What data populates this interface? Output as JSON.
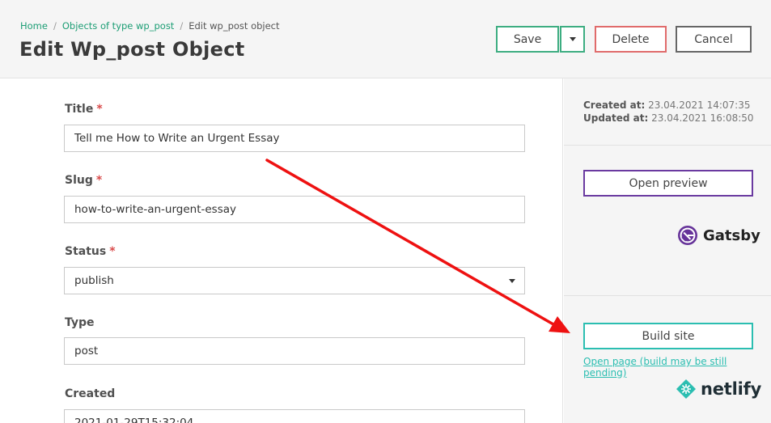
{
  "breadcrumb": {
    "home": "Home",
    "parent": "Objects of type wp_post",
    "current": "Edit wp_post object",
    "separator": "/"
  },
  "header": {
    "title": "Edit Wp_post Object",
    "save_label": "Save",
    "delete_label": "Delete",
    "cancel_label": "Cancel"
  },
  "form": {
    "required_marker": "*",
    "title_label": "Title",
    "title_value": "Tell me How to Write an Urgent Essay",
    "slug_label": "Slug",
    "slug_value": "how-to-write-an-urgent-essay",
    "status_label": "Status",
    "status_value": "publish",
    "type_label": "Type",
    "type_value": "post",
    "created_label": "Created",
    "created_value": "2021-01-29T15:32:04"
  },
  "sidebar": {
    "created_label": "Created at:",
    "created_value": "23.04.2021 14:07:35",
    "updated_label": "Updated at:",
    "updated_value": "23.04.2021 16:08:50",
    "preview_label": "Open preview",
    "gatsby_name": "Gatsby",
    "build_label": "Build site",
    "open_page_link": "Open page (build may be still pending)",
    "netlify_name": "netlify"
  },
  "colors": {
    "accent_green": "#3dad81",
    "danger": "#e06b6b",
    "gatsby_purple": "#663399",
    "netlify_teal": "#2bbeb1",
    "annotation_arrow": "#ee1111"
  },
  "icons": [
    "chevron-down-icon",
    "gatsby-logo-icon",
    "netlify-logo-icon",
    "annotation-arrow"
  ]
}
